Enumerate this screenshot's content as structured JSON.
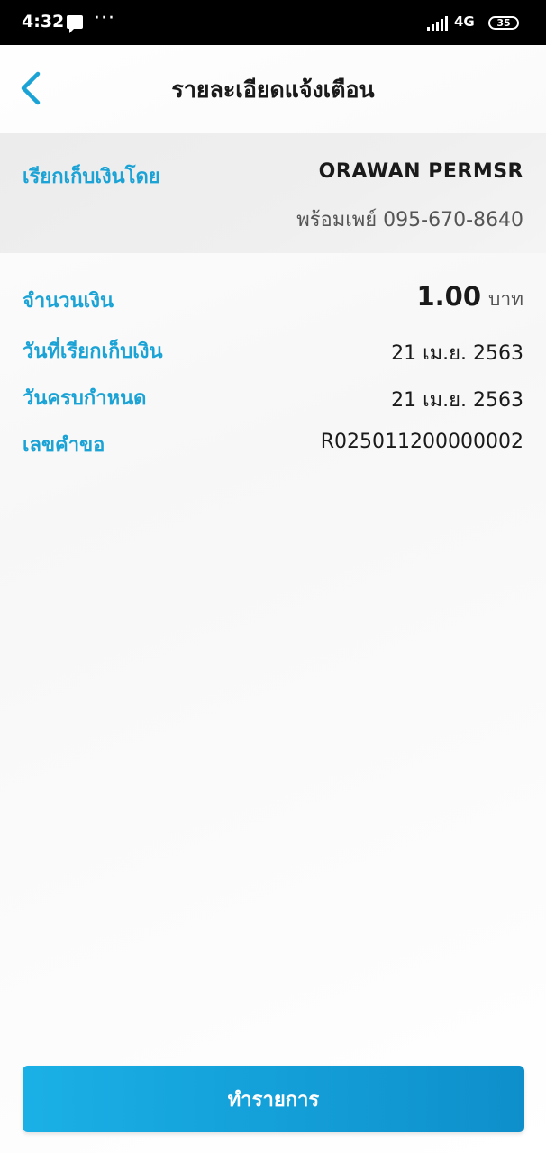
{
  "status_bar": {
    "time": "4:32",
    "dots": "···",
    "network": "4G",
    "battery": "35"
  },
  "header": {
    "title": "รายละเอียดแจ้งเตือน"
  },
  "requester": {
    "label": "เรียกเก็บเงินโดย",
    "name": "ORAWAN PERMSR",
    "phone": "พร้อมเพย์ 095-670-8640"
  },
  "details": {
    "amount_label": "จำนวนเงิน",
    "amount_value": "1.00",
    "amount_unit": "บาท",
    "request_date_label": "วันที่เรียกเก็บเงิน",
    "request_date_value": "21 เม.ย. 2563",
    "due_date_label": "วันครบกำหนด",
    "due_date_value": "21 เม.ย. 2563",
    "ref_label": "เลขคำขอ",
    "ref_value": "R025011200000002"
  },
  "actions": {
    "pay_label": "ทำรายการ"
  },
  "colors": {
    "accent": "#1ba3d6",
    "button_start": "#1ab0e6",
    "button_end": "#0e8fcb"
  }
}
